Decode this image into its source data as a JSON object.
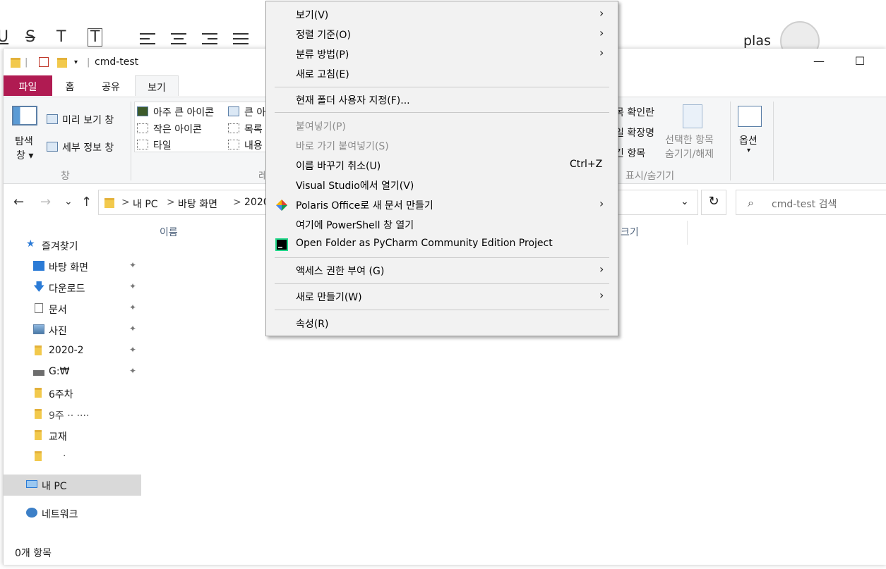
{
  "background_app": {
    "toolbar_glyphs": [
      "U",
      "S",
      "T",
      "T"
    ],
    "user_name": "plas"
  },
  "window": {
    "title": "cmd-test",
    "quick_access_separator": "|",
    "minimize": "—",
    "maximize": "☐"
  },
  "ribbon_tabs": [
    "파일",
    "홈",
    "공유",
    "보기"
  ],
  "ribbon": {
    "navigation_pane_label_1": "탐색",
    "navigation_pane_label_2": "창 ▾",
    "preview_pane": "미리 보기 창",
    "details_pane": "세부 정보 창",
    "panes_group": "창",
    "extra_large_icons": "아주 큰 아이콘",
    "large_icons": "큰 아",
    "small_icons": "작은 아이콘",
    "list": "목록",
    "tiles": "타일",
    "content": "내용",
    "layout_group": "레",
    "item_checkboxes": "목 확인란",
    "file_extensions": "일 확장명",
    "hidden_items": "긴 항목",
    "hide_selected_1": "선택한 항목",
    "hide_selected_2": "숨기기/해제",
    "show_hide_group": "표시/숨기기",
    "options_1": "옵션",
    "options_2": "▾"
  },
  "address_bar": {
    "back": "←",
    "forward": "→",
    "recent": "⌄",
    "up": "↑",
    "crumbs": [
      "내 PC",
      "바탕 화면",
      "2020"
    ],
    "crumb_sep": ">",
    "dropdown": "⌄",
    "refresh": "↻",
    "search_placeholder": "cmd-test 검색",
    "search_icon": "⌕"
  },
  "nav_pane": {
    "items": [
      {
        "label": "즐겨찾기",
        "icon": "star-icon"
      },
      {
        "label": "바탕 화면",
        "icon": "desktop-icon",
        "pinned": true
      },
      {
        "label": "다운로드",
        "icon": "download-icon",
        "pinned": true
      },
      {
        "label": "문서",
        "icon": "document-icon",
        "pinned": true
      },
      {
        "label": "사진",
        "icon": "picture-icon",
        "pinned": true
      },
      {
        "label": "2020-2",
        "icon": "folder-icon",
        "pinned": true
      },
      {
        "label": "G:₩",
        "icon": "drive-icon",
        "pinned": true
      },
      {
        "label": "6주차",
        "icon": "folder-icon"
      },
      {
        "label": "9주 ·· ····",
        "icon": "folder-icon"
      },
      {
        "label": "교재",
        "icon": "folder-icon"
      },
      {
        "label": "·",
        "icon": "folder-icon"
      },
      {
        "label": "내 PC",
        "icon": "pc-icon",
        "selected": true
      },
      {
        "label": "네트워크",
        "icon": "network-icon"
      }
    ],
    "pin_glyph": "📌"
  },
  "columns": {
    "name": "이름",
    "size": "크기"
  },
  "status_bar": "0개 항목",
  "context_menu": {
    "arrow": "›",
    "items": [
      {
        "label": "보기(V)",
        "submenu": true
      },
      {
        "label": "정렬 기준(O)",
        "submenu": true
      },
      {
        "label": "분류 방법(P)",
        "submenu": true
      },
      {
        "label": "새로 고침(E)"
      },
      {
        "label": "현재 폴더 사용자 지정(F)..."
      },
      {
        "label": "붙여넣기(P)",
        "disabled": true
      },
      {
        "label": "바로 가기 붙여넣기(S)",
        "disabled": true
      },
      {
        "label": "이름 바꾸기 취소(U)",
        "shortcut": "Ctrl+Z"
      },
      {
        "label": "Visual Studio에서 열기(V)"
      },
      {
        "label": "Polaris Office로 새 문서 만들기",
        "submenu": true,
        "icon": "polaris-icon"
      },
      {
        "label": "여기에 PowerShell 창 열기"
      },
      {
        "label": "Open Folder as PyCharm Community Edition Project",
        "icon": "pycharm-icon"
      },
      {
        "label": "액세스 권한 부여 (G)",
        "submenu": true
      },
      {
        "label": "새로 만들기(W)",
        "submenu": true
      },
      {
        "label": "속성(R)"
      }
    ]
  },
  "colors": {
    "file_tab": "#b01b52",
    "menu_bg": "#f2f2f2",
    "selected_nav": "#d9d9d9",
    "folder": "#f2c94c"
  }
}
